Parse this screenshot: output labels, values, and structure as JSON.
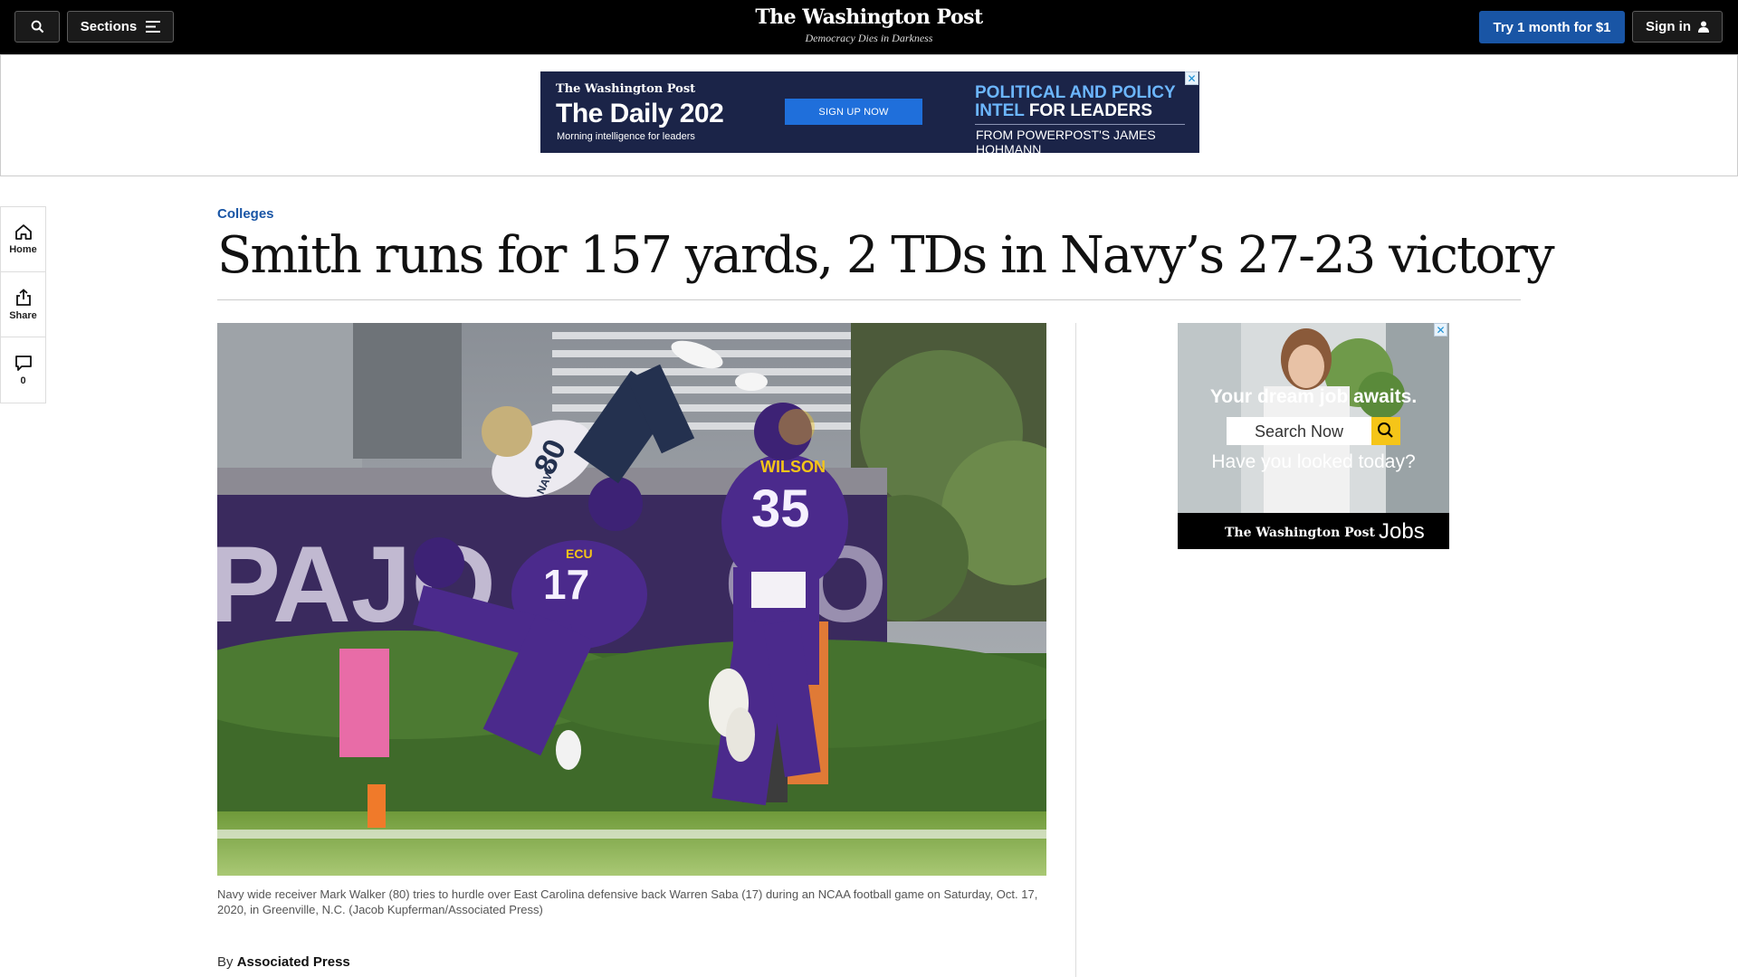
{
  "header": {
    "sections_label": "Sections",
    "logo_name": "The Washington Post",
    "logo_tagline": "Democracy Dies in Darkness",
    "subscribe_label": "Try 1 month for $1",
    "signin_label": "Sign in"
  },
  "top_ad": {
    "brand": "The Washington Post",
    "title": "The Daily 202",
    "subtitle": "Morning intelligence for leaders",
    "cta": "SIGN UP NOW",
    "pitch_blue": "POLITICAL AND POLICY INTEL",
    "pitch_white": "FOR LEADERS",
    "from": "FROM POWERPOST'S JAMES HOHMANN",
    "close": "✕"
  },
  "rail": {
    "home": "Home",
    "share": "Share",
    "comments_count": "0"
  },
  "article": {
    "kicker": "Colleges",
    "headline": "Smith runs for 157 yards, 2 TDs in Navy’s 27-23 victory",
    "caption": "Navy wide receiver Mark Walker (80) tries to hurdle over East Carolina defensive back Warren Saba (17) during an NCAA football game on Saturday, Oct. 17, 2020, in Greenville, N.C. (Jacob Kupferman/Associated Press)",
    "byline_prefix": "By",
    "byline_author": "Associated Press",
    "photo_text": {
      "stadium_sign": "PAJO",
      "stadium_sign_2": "CO",
      "jersey_wilson_name": "WILSON",
      "jersey_wilson_number": "35",
      "jersey_ecu_number": "17",
      "jersey_ecu_name": "ECU",
      "jersey_navy_name": "NAVY",
      "jersey_navy_number": "80"
    }
  },
  "side_ad": {
    "headline": "Your dream job awaits.",
    "search_placeholder": "Search Now",
    "question": "Have you looked today?",
    "brand": "The Washington Post",
    "product": "Jobs",
    "close": "✕"
  },
  "colors": {
    "accent_blue": "#1955a5",
    "ad_navy": "#1b2448",
    "ecu_purple": "#4b2a8c",
    "jobs_yellow": "#f5c518"
  }
}
